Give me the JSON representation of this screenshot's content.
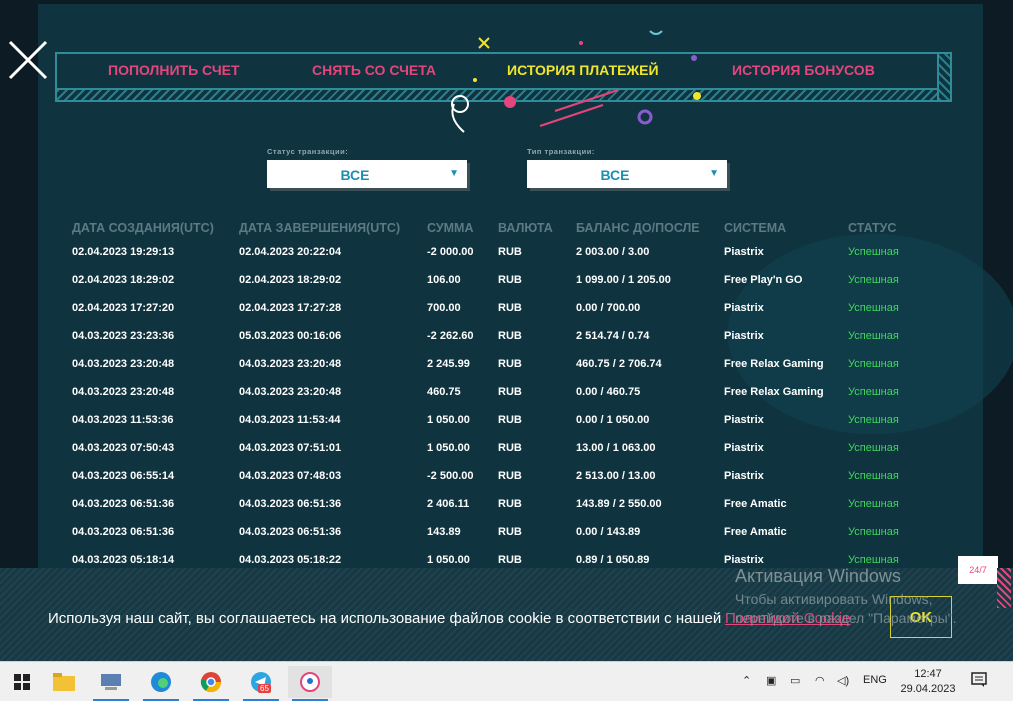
{
  "tabs": [
    {
      "label": "ПОПОЛНИТЬ СЧЕТ",
      "active": false
    },
    {
      "label": "СНЯТЬ СО СЧЕТА",
      "active": false
    },
    {
      "label": "ИСТОРИЯ ПЛАТЕЖЕЙ",
      "active": true
    },
    {
      "label": "ИСТОРИЯ БОНУСОВ",
      "active": false
    }
  ],
  "filters": {
    "status": {
      "label": "Статус транзакции:",
      "value": "ВСЕ"
    },
    "type": {
      "label": "Тип транзакции:",
      "value": "ВСЕ"
    }
  },
  "table": {
    "headers": [
      "ДАТА СОЗДАНИЯ(UTC)",
      "ДАТА ЗАВЕРШЕНИЯ(UTC)",
      "СУММА",
      "ВАЛЮТА",
      "БАЛАНС ДО/ПОСЛЕ",
      "СИСТЕМА",
      "СТАТУС"
    ],
    "rows": [
      [
        "02.04.2023 19:29:13",
        "02.04.2023 20:22:04",
        "-2 000.00",
        "RUB",
        "2 003.00 / 3.00",
        "Piastrix",
        "Успешная"
      ],
      [
        "02.04.2023 18:29:02",
        "02.04.2023 18:29:02",
        "106.00",
        "RUB",
        "1 099.00 / 1 205.00",
        "Free Play'n GO",
        "Успешная"
      ],
      [
        "02.04.2023 17:27:20",
        "02.04.2023 17:27:28",
        "700.00",
        "RUB",
        "0.00 / 700.00",
        "Piastrix",
        "Успешная"
      ],
      [
        "04.03.2023 23:23:36",
        "05.03.2023 00:16:06",
        "-2 262.60",
        "RUB",
        "2 514.74 / 0.74",
        "Piastrix",
        "Успешная"
      ],
      [
        "04.03.2023 23:20:48",
        "04.03.2023 23:20:48",
        "2 245.99",
        "RUB",
        "460.75 / 2 706.74",
        "Free Relax Gaming",
        "Успешная"
      ],
      [
        "04.03.2023 23:20:48",
        "04.03.2023 23:20:48",
        "460.75",
        "RUB",
        "0.00 / 460.75",
        "Free Relax Gaming",
        "Успешная"
      ],
      [
        "04.03.2023 11:53:36",
        "04.03.2023 11:53:44",
        "1 050.00",
        "RUB",
        "0.00 / 1 050.00",
        "Piastrix",
        "Успешная"
      ],
      [
        "04.03.2023 07:50:43",
        "04.03.2023 07:51:01",
        "1 050.00",
        "RUB",
        "13.00 / 1 063.00",
        "Piastrix",
        "Успешная"
      ],
      [
        "04.03.2023 06:55:14",
        "04.03.2023 07:48:03",
        "-2 500.00",
        "RUB",
        "2 513.00 / 13.00",
        "Piastrix",
        "Успешная"
      ],
      [
        "04.03.2023 06:51:36",
        "04.03.2023 06:51:36",
        "2 406.11",
        "RUB",
        "143.89 / 2 550.00",
        "Free Amatic",
        "Успешная"
      ],
      [
        "04.03.2023 06:51:36",
        "04.03.2023 06:51:36",
        "143.89",
        "RUB",
        "0.00 / 143.89",
        "Free Amatic",
        "Успешная"
      ],
      [
        "04.03.2023 05:18:14",
        "04.03.2023 05:18:22",
        "1 050.00",
        "RUB",
        "0.89 / 1 050.89",
        "Piastrix",
        "Успешная"
      ]
    ]
  },
  "cookie": {
    "text": "Используя наш сайт, вы соглашаетесь на использование файлов cookie в соответствии с нашей",
    "link": "Политикой Cookie",
    "ok": "OK"
  },
  "watermark": {
    "title": "Активация Windows",
    "text": "Чтобы активировать Windows, перейдите в раздел \"Параметры\"."
  },
  "side_badge": "24/7",
  "taskbar": {
    "telegram_badge": "65",
    "lang": "ENG",
    "time": "12:47",
    "date": "29.04.2023"
  },
  "colors": {
    "accent_pink": "#e4457c",
    "accent_yellow": "#f1e62b",
    "status_green": "#3fd65c",
    "panel_bg": "#0f3440"
  }
}
